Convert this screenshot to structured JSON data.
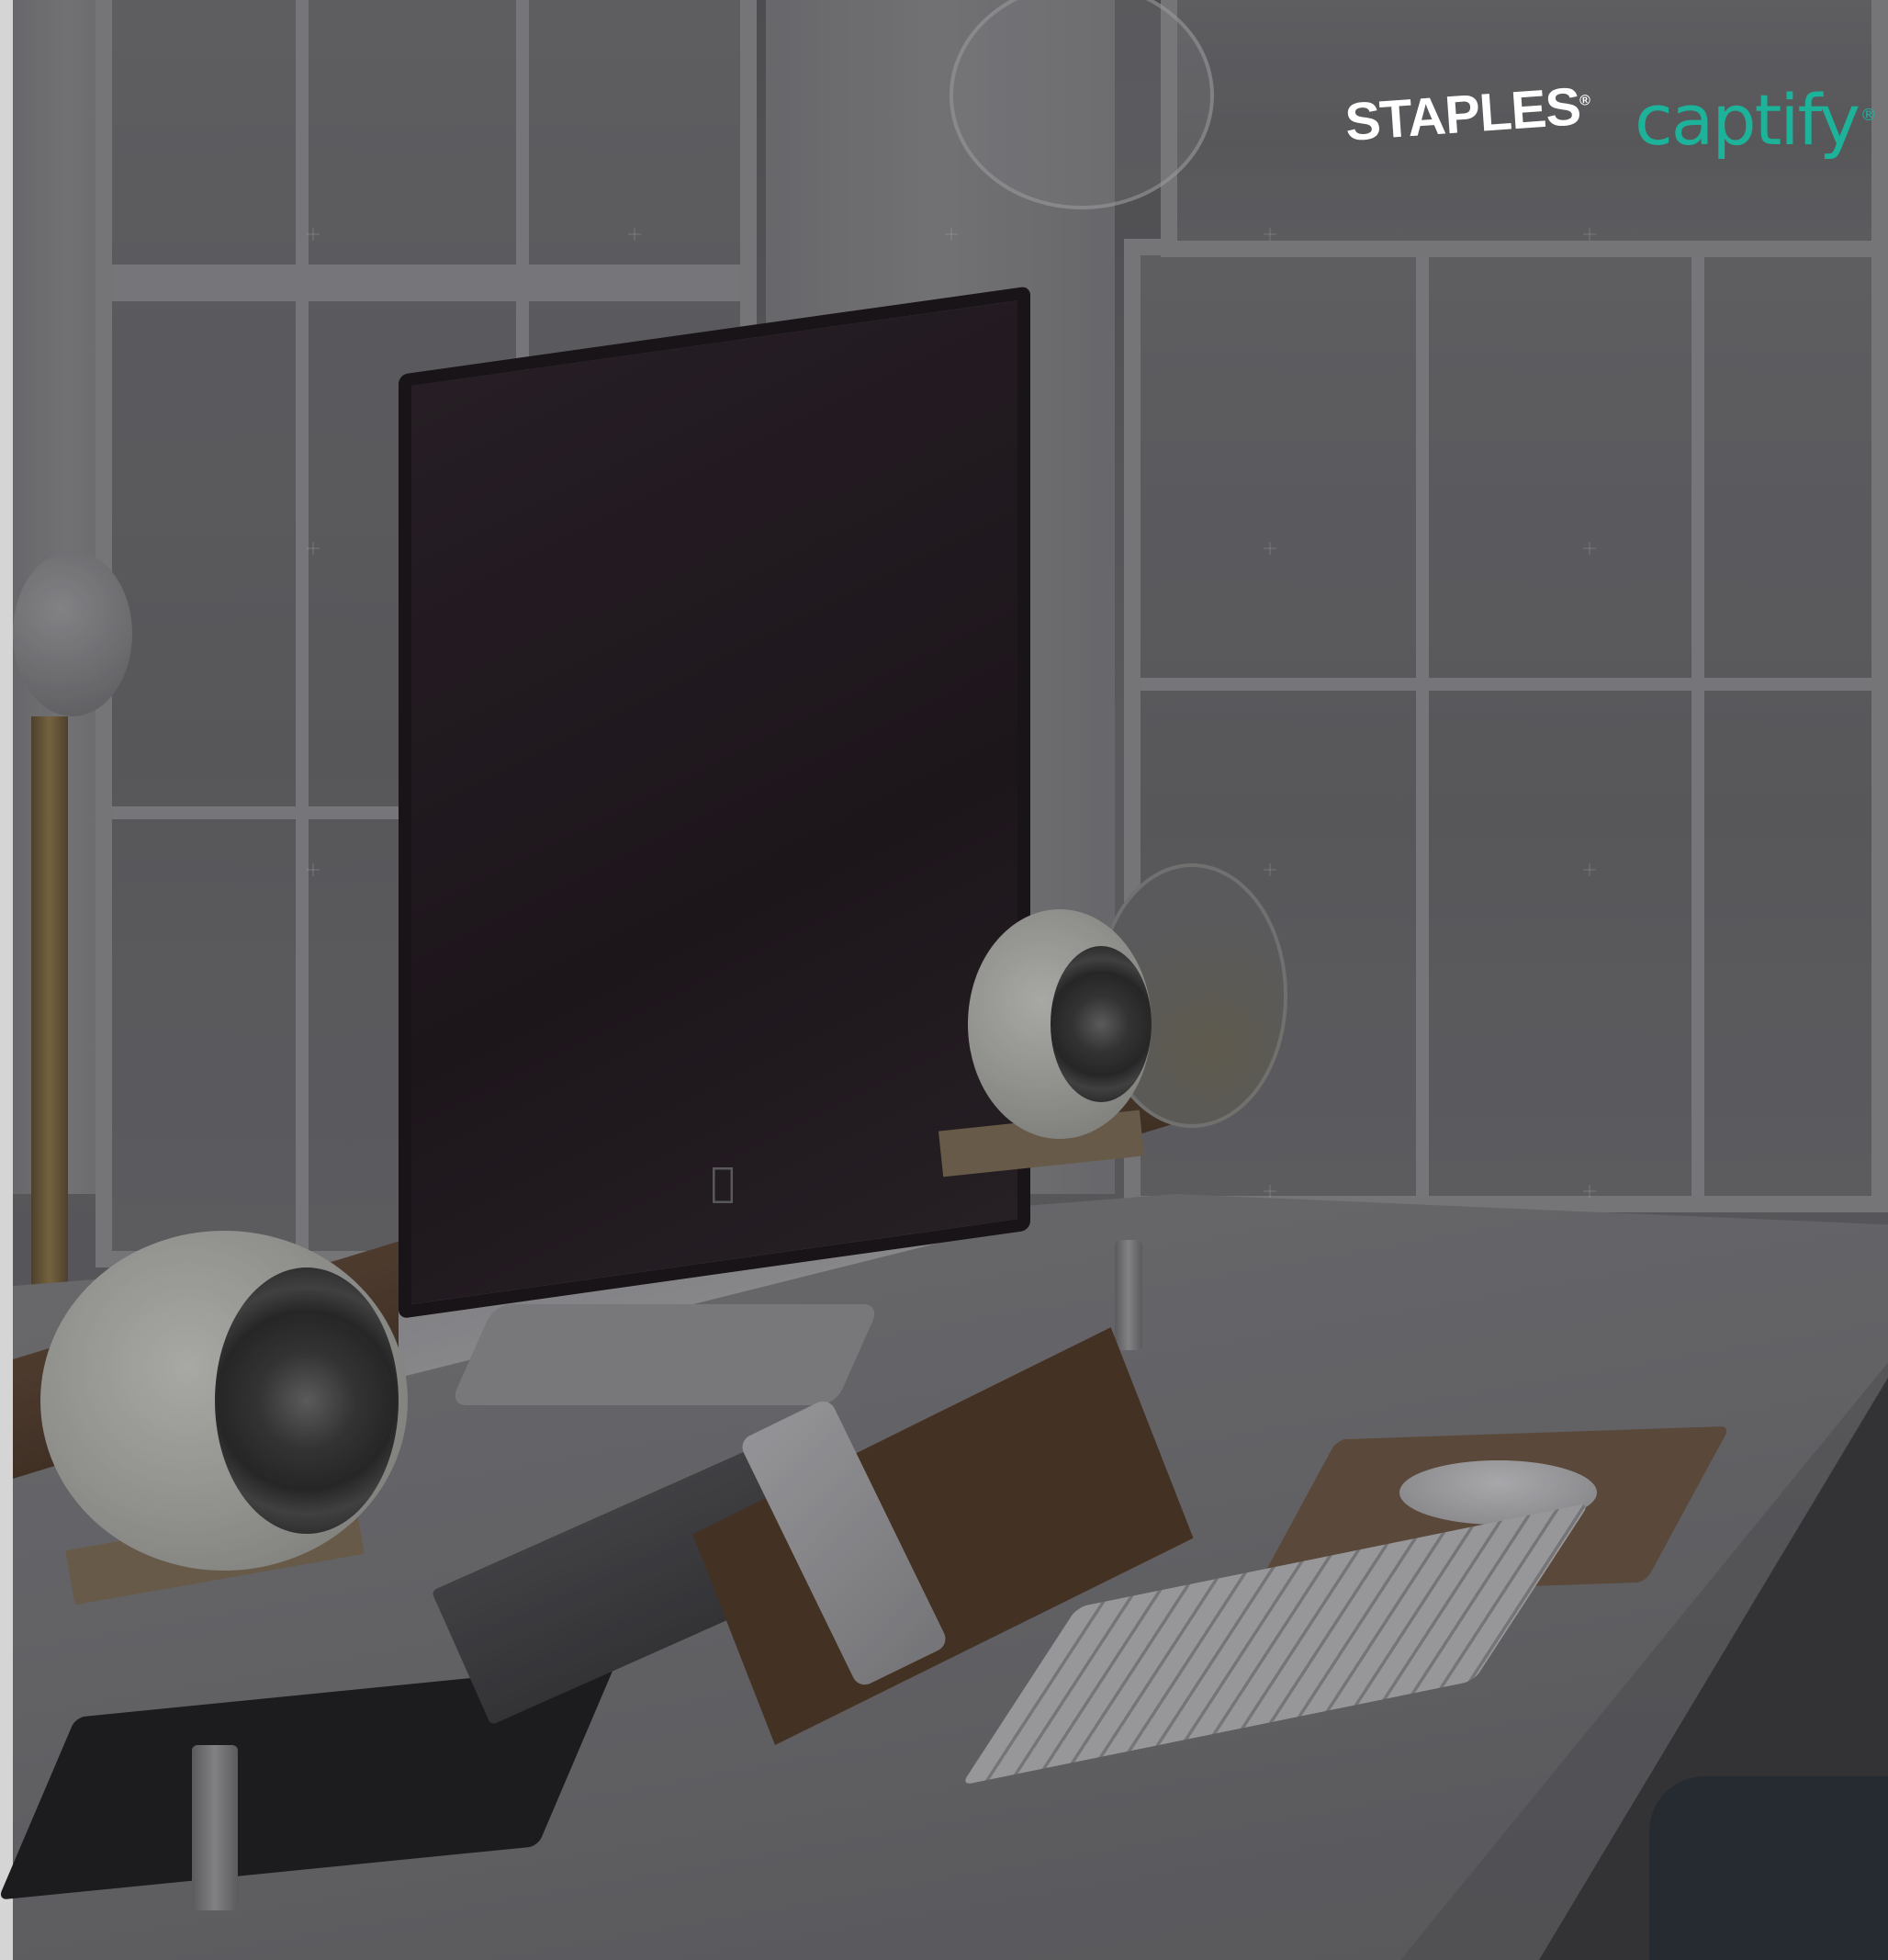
{
  "logos": {
    "staples": {
      "text": "STAPLES",
      "mark": "®",
      "color": "#ffffff"
    },
    "captify": {
      "text": "captify",
      "mark": "®",
      "color": "#1db39a"
    }
  },
  "scene": {
    "description_icon": "desk-workspace-photo",
    "overlay_color": "#141418"
  }
}
